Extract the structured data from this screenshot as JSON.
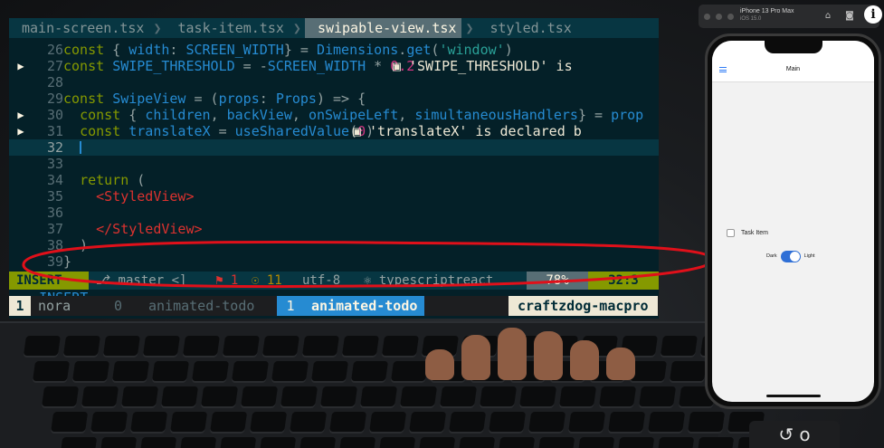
{
  "tabs": [
    {
      "label": "main-screen.tsx",
      "active": false
    },
    {
      "label": "task-item.tsx",
      "active": false
    },
    {
      "label": "swipable-view.tsx",
      "active": true
    },
    {
      "label": "styled.tsx",
      "active": false
    }
  ],
  "code_lines": [
    {
      "num": "26",
      "text": "const { width: SCREEN_WIDTH} = Dimensions.get('window')",
      "marker": ""
    },
    {
      "num": "27",
      "text": "const SWIPE_THRESHOLD = -SCREEN_WIDTH * 0.2",
      "hint": "'SWIPE_THRESHOLD' is",
      "marker": "▶"
    },
    {
      "num": "28",
      "text": "",
      "marker": ""
    },
    {
      "num": "29",
      "text": "const SwipeView = (props: Props) => {",
      "marker": ""
    },
    {
      "num": "30",
      "text": "  const { children, backView, onSwipeLeft, simultaneousHandlers} = prop",
      "marker": "▶"
    },
    {
      "num": "31",
      "text": "  const translateX = useSharedValue(0)",
      "hint": "'translateX' is declared b",
      "marker": "▶"
    },
    {
      "num": "32",
      "text": "  ",
      "marker": "",
      "current": true
    },
    {
      "num": "33",
      "text": "",
      "marker": ""
    },
    {
      "num": "34",
      "text": "  return (",
      "marker": ""
    },
    {
      "num": "35",
      "text": "    <StyledView>",
      "marker": ""
    },
    {
      "num": "36",
      "text": "",
      "marker": ""
    },
    {
      "num": "37",
      "text": "    </StyledView>",
      "marker": ""
    },
    {
      "num": "38",
      "text": "  )",
      "marker": ""
    },
    {
      "num": "39",
      "text": "}",
      "marker": ""
    }
  ],
  "statusline": {
    "mode": "INSERT",
    "branch": "⎇ master",
    "branch_suffix": "<]",
    "errors": "⚑ 1",
    "warnings": "☉ 11",
    "encoding": "utf-8",
    "filetype": "⚛ typescriptreact",
    "percent": "78%",
    "position": "32:3"
  },
  "cmdline": "-- INSERT --",
  "tmux": {
    "session_num": "1",
    "session_name": "nora",
    "window0_num": "0",
    "window0_name": "animated-todo",
    "active_num": "1",
    "active_name": "animated-todo",
    "host": "craftzdog-macpro"
  },
  "simulator": {
    "device": "iPhone 13 Pro Max",
    "os": "iOS 15.0",
    "nav_title": "Main",
    "task_label": "Task Item",
    "theme_dark": "Dark",
    "theme_light": "Light",
    "toggle_on": true
  },
  "icons": {
    "home": "home-icon",
    "screenshot": "camera-icon",
    "rotate": "rotate-icon",
    "info": "info-icon",
    "replay": "replay-icon"
  },
  "replay_label": "↺ o",
  "colors": {
    "accent": "#859900",
    "annotation": "#e0101a",
    "toggle": "#2f6fd6"
  }
}
